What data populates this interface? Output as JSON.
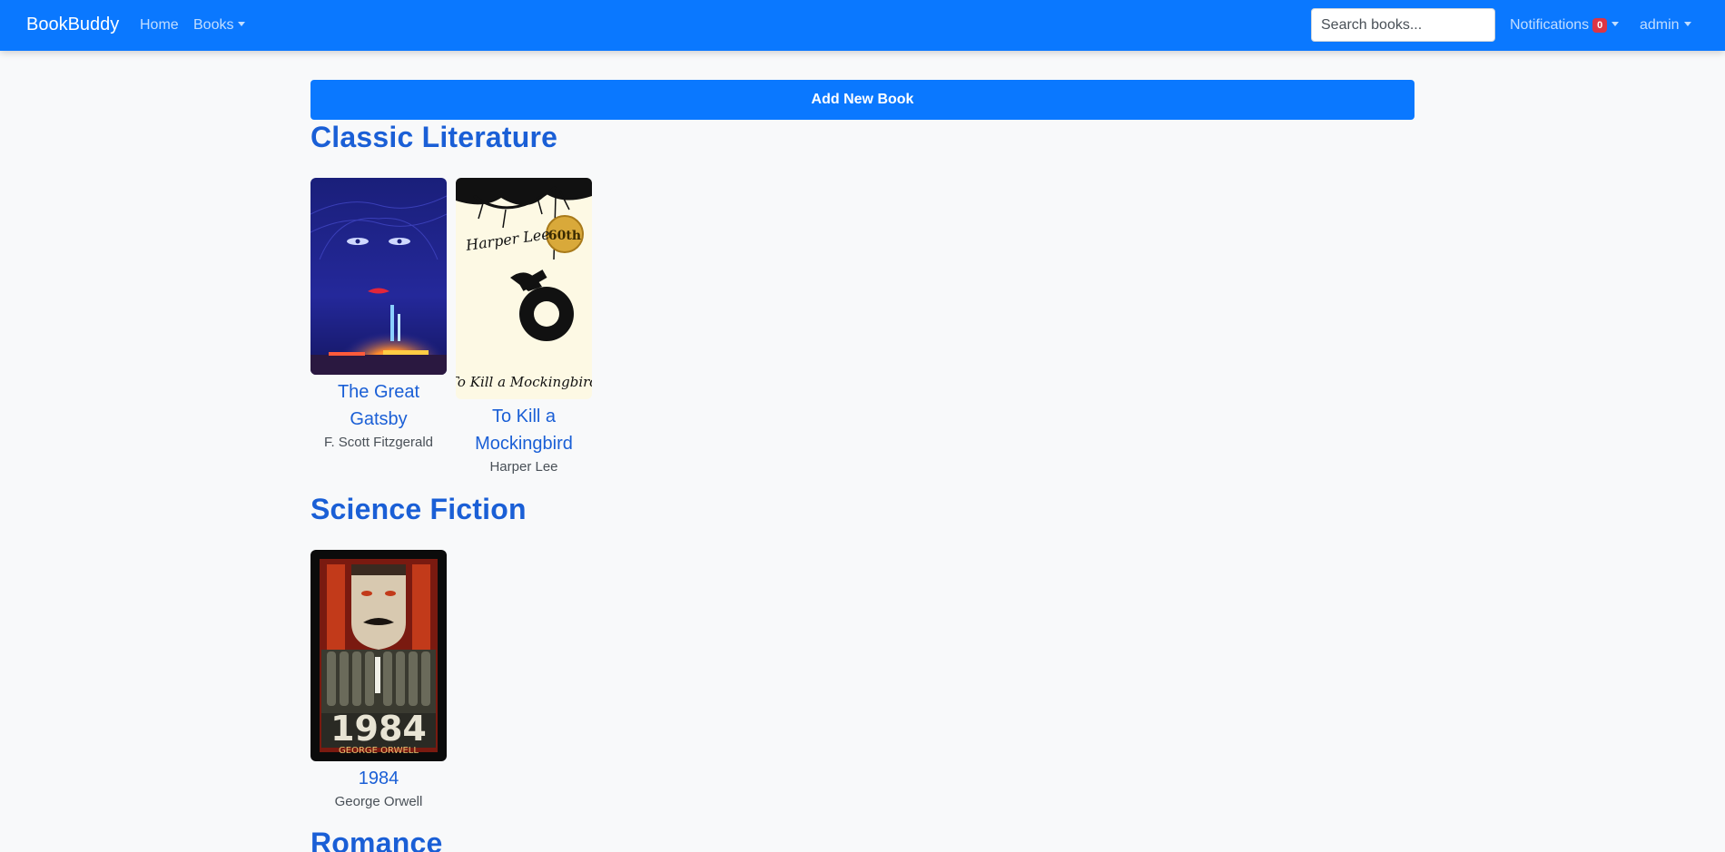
{
  "navbar": {
    "brand": "BookBuddy",
    "home_label": "Home",
    "books_label": "Books",
    "search_placeholder": "Search books...",
    "notifications_label": "Notifications",
    "notifications_count": "0",
    "user_label": "admin",
    "accent_color": "#0a78ff"
  },
  "main": {
    "add_button_label": "Add New Book",
    "sections": [
      {
        "title": "Classic Literature",
        "books": [
          {
            "title": "The Great Gatsby",
            "author": "F. Scott Fitzgerald"
          },
          {
            "title": "To Kill a Mockingbird",
            "author": "Harper Lee"
          }
        ]
      },
      {
        "title": "Science Fiction",
        "books": [
          {
            "title": "1984",
            "author": "George Orwell"
          }
        ]
      },
      {
        "title": "Romance",
        "books": []
      }
    ]
  },
  "covers": {
    "mockingbird_author_text": "Harper Lee",
    "mockingbird_title_text": "To Kill a Mockingbird",
    "mockingbird_seal_text": "60th",
    "orwell_title_text": "1984",
    "orwell_author_text": "GEORGE ORWELL"
  }
}
